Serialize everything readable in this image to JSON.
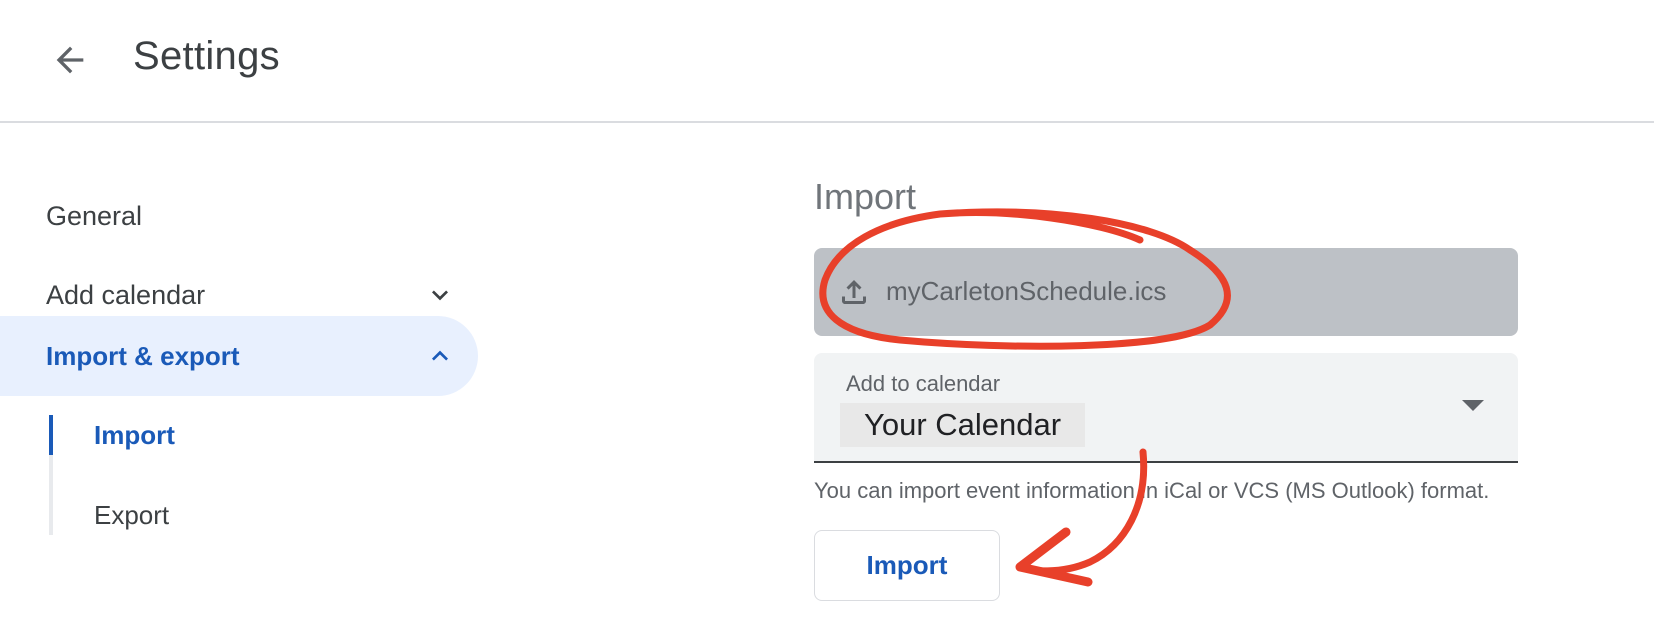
{
  "header": {
    "back_icon": "arrow-back-icon",
    "title": "Settings"
  },
  "nav": {
    "items": [
      {
        "label": "General"
      },
      {
        "label": "Add calendar",
        "icon": "chevron-down-icon"
      },
      {
        "label": "Import & export",
        "icon": "chevron-up-icon",
        "active": true
      }
    ],
    "sub_items": [
      {
        "label": "Import",
        "active": true
      },
      {
        "label": "Export"
      }
    ]
  },
  "main": {
    "section_title": "Import",
    "file": {
      "icon": "upload-icon",
      "name": "myCarletonSchedule.ics"
    },
    "calendar_select": {
      "label": "Add to calendar",
      "value": "Your Calendar",
      "icon": "dropdown-arrow-icon"
    },
    "help_text": "You can import event information in iCal or VCS (MS Outlook) format.",
    "import_button": "Import"
  },
  "colors": {
    "accent": "#1a5ab8",
    "active_bg": "#e8f0fe",
    "file_box_bg": "#bdc1c6",
    "select_bg": "#f1f3f4",
    "annotation": "#e8402a"
  }
}
